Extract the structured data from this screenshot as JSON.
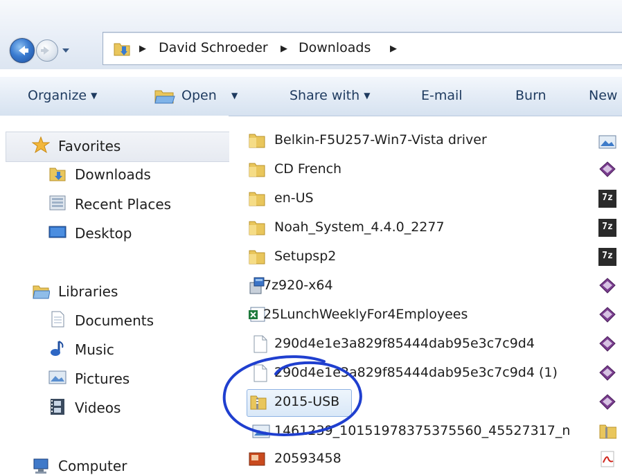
{
  "breadcrumbs": [
    "David Schroeder",
    "Downloads"
  ],
  "commands": {
    "organize": "Organize",
    "open": "Open",
    "share_with": "Share with",
    "email": "E-mail",
    "burn": "Burn",
    "new_folder_partial": "New"
  },
  "nav": {
    "favorites": "Favorites",
    "downloads": "Downloads",
    "recent_places": "Recent Places",
    "desktop": "Desktop",
    "libraries": "Libraries",
    "documents": "Documents",
    "music": "Music",
    "pictures": "Pictures",
    "videos": "Videos",
    "computer": "Computer"
  },
  "files": [
    {
      "name": "Belkin-F5U257-Win7-Vista driver",
      "icon": "folder-icon"
    },
    {
      "name": "CD French",
      "icon": "folder-icon"
    },
    {
      "name": "en-US",
      "icon": "folder-icon"
    },
    {
      "name": "Noah_System_4.4.0_2277",
      "icon": "folder-icon"
    },
    {
      "name": "Setupsp2",
      "icon": "folder-icon"
    },
    {
      "name": "7z920-x64",
      "icon": "installer-icon"
    },
    {
      "name": "25LunchWeeklyFor4Employees",
      "icon": "excel-icon"
    },
    {
      "name": "290d4e1e3a829f85444dab95e3c7c9d4",
      "icon": "file-icon"
    },
    {
      "name": "290d4e1e3a829f85444dab95e3c7c9d4 (1)",
      "icon": "file-icon"
    },
    {
      "name": "2015-USB",
      "icon": "zip-folder-icon",
      "selected": true
    },
    {
      "name": "1461239_10151978375375560_45527317_n",
      "icon": "image-icon"
    },
    {
      "name": "20593458",
      "icon": "image-app-icon"
    }
  ],
  "right_column_icons": [
    "image-icon",
    "package-icon",
    "7z-icon",
    "7z-icon",
    "7z-icon",
    "package-icon",
    "package-icon",
    "package-icon",
    "package-icon",
    "package-icon",
    "zip-folder-icon",
    "pdf-icon"
  ],
  "right_column_7z_label": "7z",
  "colors": {
    "annotation_circle": "#1f3fcf",
    "selection_border": "#8db2e3",
    "command_text": "#1e3a5f"
  }
}
